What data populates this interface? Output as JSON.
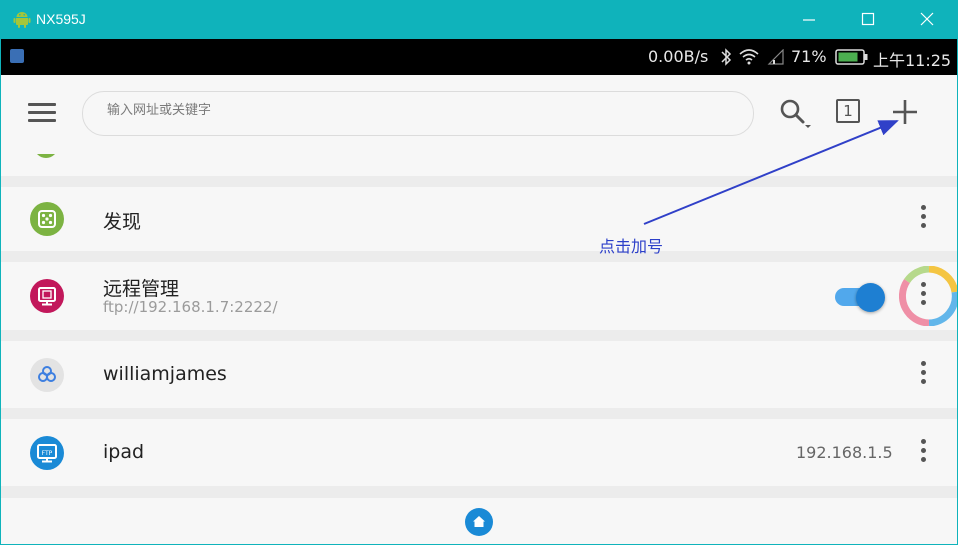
{
  "window": {
    "title": "NX595J"
  },
  "status_bar": {
    "net_rate": "0.00B/s",
    "battery_pct": "71%",
    "time": "上午11:25"
  },
  "toolbar": {
    "search_placeholder": "输入网址或关键字",
    "tab_count": "1"
  },
  "rows": [
    {
      "name": "发现",
      "icon": "dice-icon",
      "color": "#7cb342"
    },
    {
      "name": "远程管理",
      "subtitle": "ftp://192.168.1.7:2222/",
      "icon": "remote-monitor-icon",
      "color": "#c2185b",
      "toggle_on": true
    },
    {
      "name": "williamjames",
      "icon": "cloud-link-icon",
      "color": "#3d7fe0"
    },
    {
      "name": "ipad",
      "icon": "ftp-monitor-icon",
      "color": "#1a8ad6",
      "address": "192.168.1.5"
    }
  ],
  "annotation": {
    "text": "点击加号",
    "color": "#2c3fc9"
  },
  "colors": {
    "titlebar": "#0fb3bb",
    "accent": "#1e7fd2"
  }
}
